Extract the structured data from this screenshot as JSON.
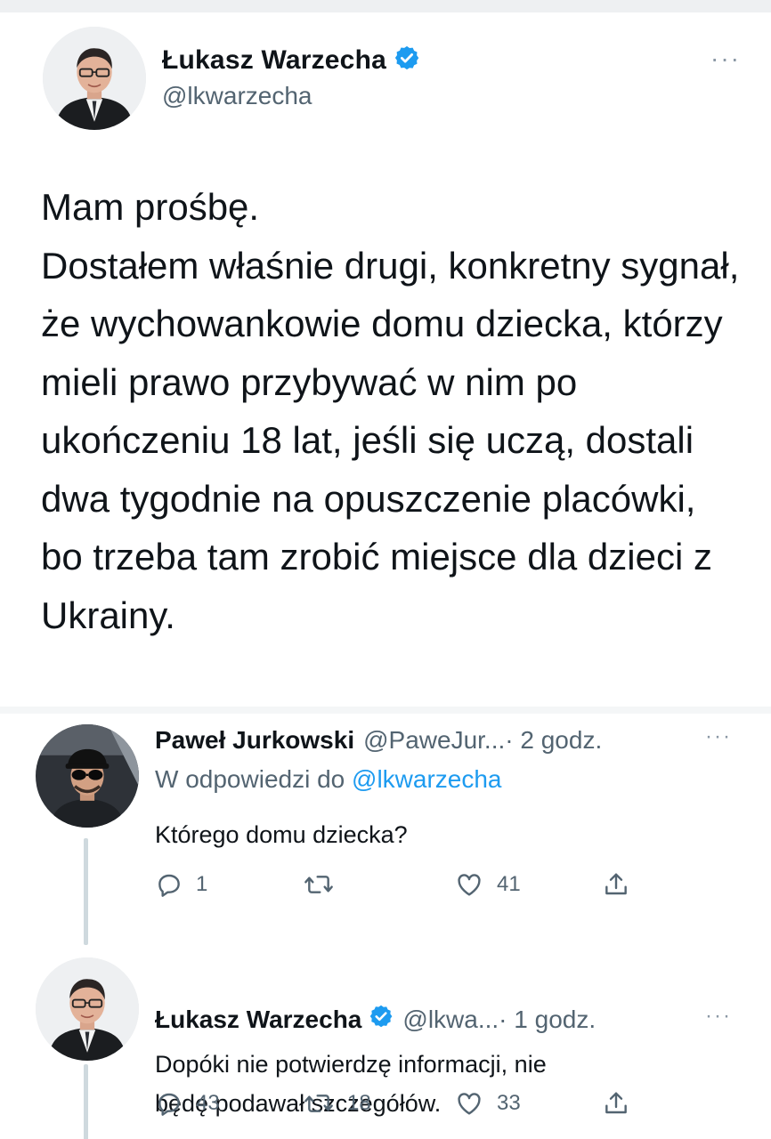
{
  "main_tweet": {
    "author_name": "Łukasz Warzecha",
    "handle": "@lkwarzecha",
    "verified": true,
    "text": "Mam prośbę.\nDostałem właśnie drugi, konkretny sygnał, że wychowankowie domu dziecka, którzy mieli prawo przybywać w nim po ukończeniu 18 lat, jeśli się uczą, dostali dwa tygodnie na opuszczenie placówki, bo trzeba tam zrobić miejsce dla dzieci z Ukrainy.",
    "more_label": "···"
  },
  "replies": [
    {
      "author_name": "Paweł Jurkowski",
      "handle": "@PaweJur...",
      "time": "· 2 godz.",
      "verified": false,
      "replying_to_prefix": "W odpowiedzi do",
      "replying_to_handle": "@lkwarzecha",
      "text": "Którego domu dziecka?",
      "more_label": "···",
      "counts": {
        "reply": "1",
        "retweet": "",
        "like": "41"
      }
    },
    {
      "author_name": "Łukasz Warzecha",
      "handle": "@lkwa...",
      "time": "· 1 godz.",
      "verified": true,
      "text": "Dopóki nie potwierdzę informacji, nie\nbędę podawał szczegółów.",
      "more_label": "···",
      "counts": {
        "reply": "43",
        "retweet": "18",
        "like": "33"
      }
    }
  ],
  "colors": {
    "verified_blue": "#1d9bf0",
    "text_primary": "#0f1419",
    "text_secondary": "#536471",
    "link": "#1d9bf0"
  },
  "icons": [
    "verified-badge-icon",
    "more-options-icon",
    "reply-icon",
    "retweet-icon",
    "like-icon",
    "share-icon"
  ]
}
